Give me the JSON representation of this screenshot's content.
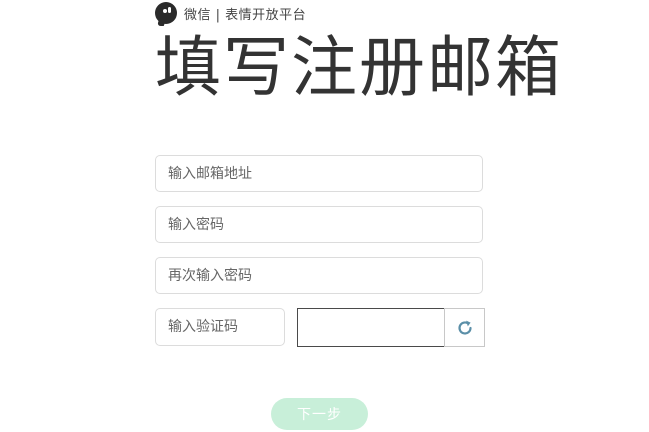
{
  "brand": {
    "text": "微信 | 表情开放平台",
    "icon": "wechat-logo-icon"
  },
  "page_title": "填写注册邮箱",
  "form": {
    "email_placeholder": "输入邮箱地址",
    "password_placeholder": "输入密码",
    "password_confirm_placeholder": "再次输入密码",
    "captcha_placeholder": "输入验证码",
    "refresh_icon": "refresh-icon"
  },
  "next_button": {
    "label": "下一步",
    "color": "#c8efd9",
    "enabled": false
  },
  "colors": {
    "refresh_icon": "#5b8fa8",
    "title": "#333333"
  }
}
